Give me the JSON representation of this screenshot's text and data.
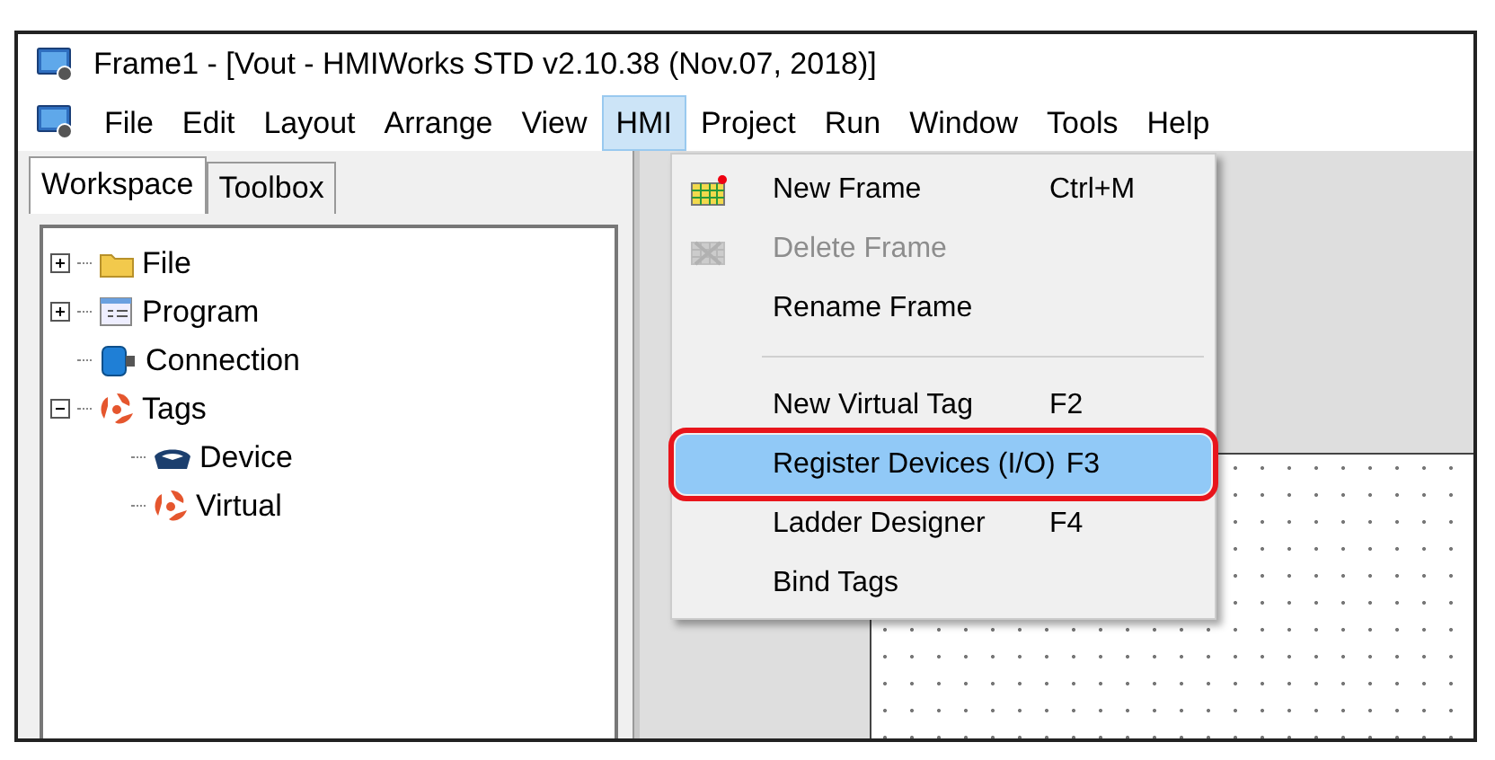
{
  "window": {
    "title": "Frame1 - [Vout - HMIWorks STD v2.10.38 (Nov.07, 2018)]"
  },
  "menu_bar": [
    {
      "label": "File",
      "selected": false
    },
    {
      "label": "Edit",
      "selected": false
    },
    {
      "label": "Layout",
      "selected": false
    },
    {
      "label": "Arrange",
      "selected": false
    },
    {
      "label": "View",
      "selected": false
    },
    {
      "label": "HMI",
      "selected": true
    },
    {
      "label": "Project",
      "selected": false
    },
    {
      "label": "Run",
      "selected": false
    },
    {
      "label": "Window",
      "selected": false
    },
    {
      "label": "Tools",
      "selected": false
    },
    {
      "label": "Help",
      "selected": false
    }
  ],
  "panel_tabs": [
    {
      "label": "Workspace",
      "selected": true
    },
    {
      "label": "Toolbox",
      "selected": false
    }
  ],
  "tree": [
    {
      "label": "File",
      "kind": "folder",
      "expanded": false
    },
    {
      "label": "Program",
      "kind": "program",
      "expanded": false
    },
    {
      "label": "Connection",
      "kind": "connection"
    },
    {
      "label": "Tags",
      "kind": "tags",
      "expanded": true,
      "children": [
        {
          "label": "Device",
          "kind": "device"
        },
        {
          "label": "Virtual",
          "kind": "tags"
        }
      ]
    }
  ],
  "hmi_menu": [
    {
      "kind": "command",
      "label": "New Frame",
      "shortcut": "Ctrl+M",
      "disabled": false,
      "selected": false
    },
    {
      "kind": "command",
      "label": "Delete Frame",
      "disabled": true,
      "selected": false
    },
    {
      "kind": "command",
      "label": "Rename Frame",
      "disabled": false,
      "selected": false
    },
    {
      "kind": "separator"
    },
    {
      "kind": "command",
      "label": "New Virtual Tag",
      "shortcut": "F2",
      "disabled": false,
      "selected": false
    },
    {
      "kind": "command",
      "label": "Register Devices (I/O)",
      "shortcut": "F3",
      "disabled": false,
      "selected": true,
      "circled": true
    },
    {
      "kind": "command",
      "label": "Ladder Designer",
      "shortcut": "F4",
      "disabled": false,
      "selected": false
    },
    {
      "kind": "command",
      "label": "Bind Tags",
      "disabled": false,
      "selected": false
    }
  ]
}
